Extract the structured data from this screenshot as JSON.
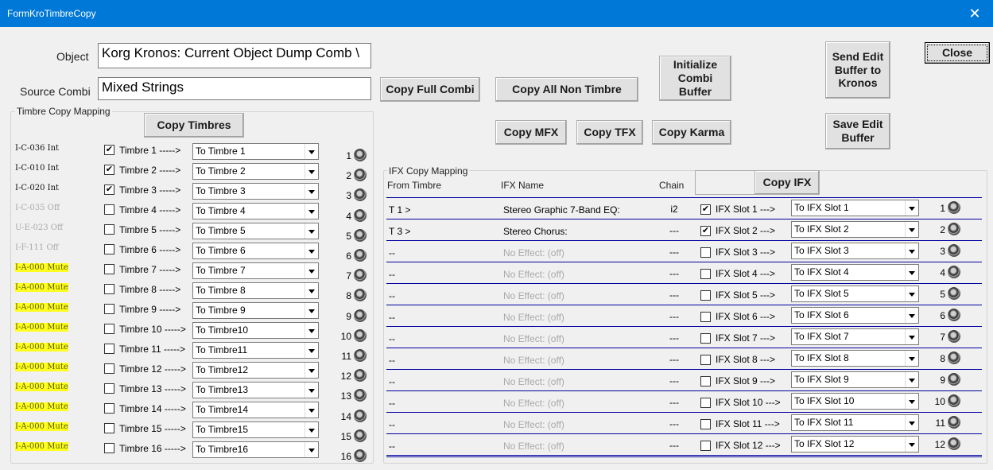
{
  "window": {
    "title": "FormKroTimbreCopy",
    "close_glyph": "✕"
  },
  "object": {
    "label": "Object",
    "value": "Korg Kronos: Current Object Dump Comb \\"
  },
  "source": {
    "label": "Source Combi",
    "value": "Mixed Strings"
  },
  "buttons": {
    "copy_full_combi": "Copy Full Combi",
    "copy_all_non_timbre": "Copy All Non Timbre",
    "initialize_combi_buffer": "Initialize Combi Buffer",
    "send_edit_buffer": "Send Edit Buffer to Kronos",
    "close": "Close",
    "save_edit_buffer": "Save Edit Buffer",
    "copy_timbres": "Copy Timbres",
    "copy_mfx": "Copy MFX",
    "copy_tfx": "Copy TFX",
    "copy_karma": "Copy Karma",
    "copy_ifx": "Copy IFX"
  },
  "timbre_group": {
    "title": "Timbre Copy Mapping"
  },
  "timbres": [
    {
      "program": "I-C-036 Int",
      "state": "int",
      "checked": "✔",
      "label": "Timbre 1 ----->",
      "target": "To Timbre  1",
      "num": "1"
    },
    {
      "program": "I-C-010 Int",
      "state": "int",
      "checked": "✔",
      "label": "Timbre 2 ----->",
      "target": "To Timbre  2",
      "num": "2"
    },
    {
      "program": "I-C-020 Int",
      "state": "int",
      "checked": "✔",
      "label": "Timbre 3 ----->",
      "target": "To Timbre  3",
      "num": "3"
    },
    {
      "program": "I-C-035 Off",
      "state": "off",
      "checked": "",
      "label": "Timbre 4 ----->",
      "target": "To Timbre  4",
      "num": "4"
    },
    {
      "program": "U-E-023 Off",
      "state": "off",
      "checked": "",
      "label": "Timbre 5 ----->",
      "target": "To Timbre  5",
      "num": "5"
    },
    {
      "program": "I-F-111 Off",
      "state": "off",
      "checked": "",
      "label": "Timbre 6 ----->",
      "target": "To Timbre  6",
      "num": "6"
    },
    {
      "program": "I-A-000 Mute",
      "state": "mute",
      "checked": "",
      "label": "Timbre 7 ----->",
      "target": "To Timbre  7",
      "num": "7"
    },
    {
      "program": "I-A-000 Mute",
      "state": "mute",
      "checked": "",
      "label": "Timbre 8 ----->",
      "target": "To Timbre  8",
      "num": "8"
    },
    {
      "program": "I-A-000 Mute",
      "state": "mute",
      "checked": "",
      "label": "Timbre 9 ----->",
      "target": "To Timbre  9",
      "num": "9"
    },
    {
      "program": "I-A-000 Mute",
      "state": "mute",
      "checked": "",
      "label": "Timbre 10 ----->",
      "target": "To Timbre10",
      "num": "10"
    },
    {
      "program": "I-A-000 Mute",
      "state": "mute",
      "checked": "",
      "label": "Timbre 11 ----->",
      "target": "To Timbre11",
      "num": "11"
    },
    {
      "program": "I-A-000 Mute",
      "state": "mute",
      "checked": "",
      "label": "Timbre 12 ----->",
      "target": "To Timbre12",
      "num": "12"
    },
    {
      "program": "I-A-000 Mute",
      "state": "mute",
      "checked": "",
      "label": "Timbre 13 ----->",
      "target": "To Timbre13",
      "num": "13"
    },
    {
      "program": "I-A-000 Mute",
      "state": "mute",
      "checked": "",
      "label": "Timbre 14 ----->",
      "target": "To Timbre14",
      "num": "14"
    },
    {
      "program": "I-A-000 Mute",
      "state": "mute",
      "checked": "",
      "label": "Timbre 15 ----->",
      "target": "To Timbre15",
      "num": "15"
    },
    {
      "program": "I-A-000 Mute",
      "state": "mute",
      "checked": "",
      "label": "Timbre 16 ----->",
      "target": "To Timbre16",
      "num": "16"
    }
  ],
  "ifx_group": {
    "title": "IFX Copy Mapping",
    "col_from": "From Timbre",
    "col_name": "IFX Name",
    "col_chain": "Chain"
  },
  "ifx": [
    {
      "from": "T 1 >",
      "name": "Stereo Graphic 7-Band EQ:",
      "state": "on",
      "chain": "i2",
      "checked": "✔",
      "label": "IFX Slot 1 --->",
      "target": "To IFX Slot  1",
      "num": "1"
    },
    {
      "from": "T 3 >",
      "name": "Stereo Chorus:",
      "state": "on",
      "chain": "---",
      "checked": "✔",
      "label": "IFX Slot 2 --->",
      "target": "To IFX Slot  2",
      "num": "2"
    },
    {
      "from": "--",
      "name": "No Effect: (off)",
      "state": "off",
      "chain": "---",
      "checked": "",
      "label": "IFX Slot 3 --->",
      "target": "To IFX Slot  3",
      "num": "3"
    },
    {
      "from": "--",
      "name": "No Effect: (off)",
      "state": "off",
      "chain": "---",
      "checked": "",
      "label": "IFX Slot 4 --->",
      "target": "To IFX Slot  4",
      "num": "4"
    },
    {
      "from": "--",
      "name": "No Effect: (off)",
      "state": "off",
      "chain": "---",
      "checked": "",
      "label": "IFX Slot 5 --->",
      "target": "To IFX Slot  5",
      "num": "5"
    },
    {
      "from": "--",
      "name": "No Effect: (off)",
      "state": "off",
      "chain": "---",
      "checked": "",
      "label": "IFX Slot 6 --->",
      "target": "To IFX Slot  6",
      "num": "6"
    },
    {
      "from": "--",
      "name": "No Effect: (off)",
      "state": "off",
      "chain": "---",
      "checked": "",
      "label": "IFX Slot 7 --->",
      "target": "To IFX Slot  7",
      "num": "7"
    },
    {
      "from": "--",
      "name": "No Effect: (off)",
      "state": "off",
      "chain": "---",
      "checked": "",
      "label": "IFX Slot 8 --->",
      "target": "To IFX Slot  8",
      "num": "8"
    },
    {
      "from": "--",
      "name": "No Effect: (off)",
      "state": "off",
      "chain": "---",
      "checked": "",
      "label": "IFX Slot 9 --->",
      "target": "To IFX Slot  9",
      "num": "9"
    },
    {
      "from": "--",
      "name": "No Effect: (off)",
      "state": "off",
      "chain": "---",
      "checked": "",
      "label": "IFX Slot 10 --->",
      "target": "To IFX Slot 10",
      "num": "10"
    },
    {
      "from": "--",
      "name": "No Effect: (off)",
      "state": "off",
      "chain": "---",
      "checked": "",
      "label": "IFX Slot 11 --->",
      "target": "To IFX Slot 11",
      "num": "11"
    },
    {
      "from": "--",
      "name": "No Effect: (off)",
      "state": "off",
      "chain": "---",
      "checked": "",
      "label": "IFX Slot 12 --->",
      "target": "To IFX Slot 12",
      "num": "12"
    }
  ],
  "colors": {
    "titlebar": "#0078d7",
    "mute_highlight": "#ffff20",
    "row_divider": "#0000a0",
    "disabled_text": "#a9a9a9"
  }
}
